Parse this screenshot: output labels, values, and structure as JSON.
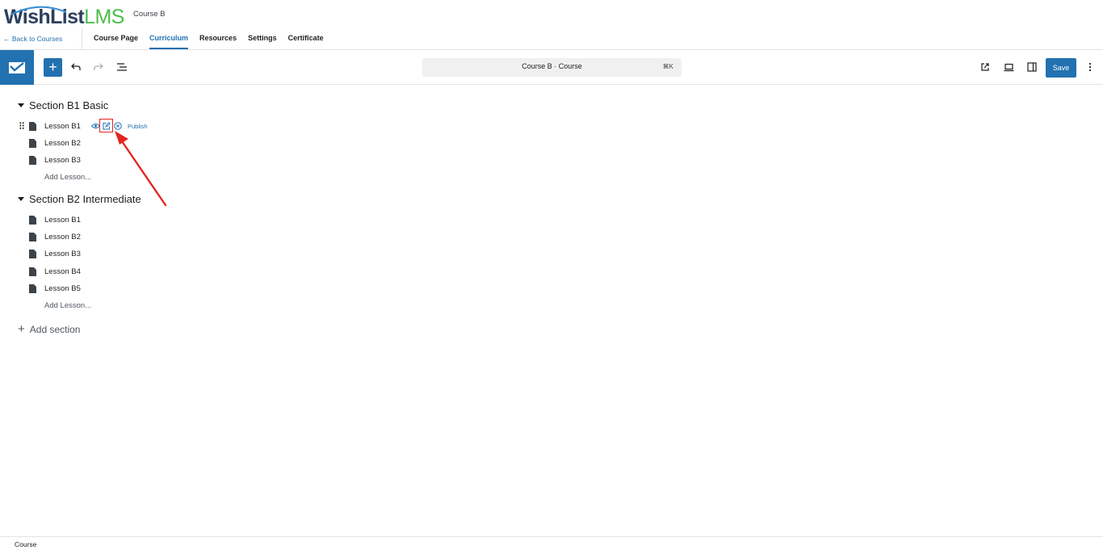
{
  "header": {
    "logo_wishlist": "WishList",
    "logo_lms": "LMS",
    "course_name": "Course B",
    "back_link": "← Back to Courses",
    "tabs": [
      {
        "label": "Course Page",
        "active": false
      },
      {
        "label": "Curriculum",
        "active": true
      },
      {
        "label": "Resources",
        "active": false
      },
      {
        "label": "Settings",
        "active": false
      },
      {
        "label": "Certificate",
        "active": false
      }
    ]
  },
  "toolbar": {
    "add_label": "+",
    "document_title": "Course B · Course",
    "shortcut": "⌘K",
    "save_label": "Save",
    "icons": [
      "wishlist-logo-icon",
      "undo-icon",
      "redo-icon",
      "list-view-icon",
      "external-link-icon",
      "device-preview-icon",
      "sidebar-toggle-icon",
      "more-options-icon"
    ]
  },
  "curriculum": {
    "sections": [
      {
        "title": "Section B1 Basic",
        "lessons": [
          "Lesson B1",
          "Lesson B2",
          "Lesson B3"
        ],
        "add_lesson": "Add Lesson..."
      },
      {
        "title": "Section B2 Intermediate",
        "lessons": [
          "Lesson B1",
          "Lesson B2",
          "Lesson B3",
          "Lesson B4",
          "Lesson B5"
        ],
        "add_lesson": "Add Lesson..."
      }
    ],
    "row_actions": {
      "publish_label": "Publish"
    },
    "add_section_label": "Add section"
  },
  "footer": {
    "breadcrumb": "Course"
  },
  "colors": {
    "accent": "#2271b1",
    "annotation": "#e3261f",
    "logo_dark": "#2b3e5c",
    "logo_green": "#4bbd4b"
  }
}
